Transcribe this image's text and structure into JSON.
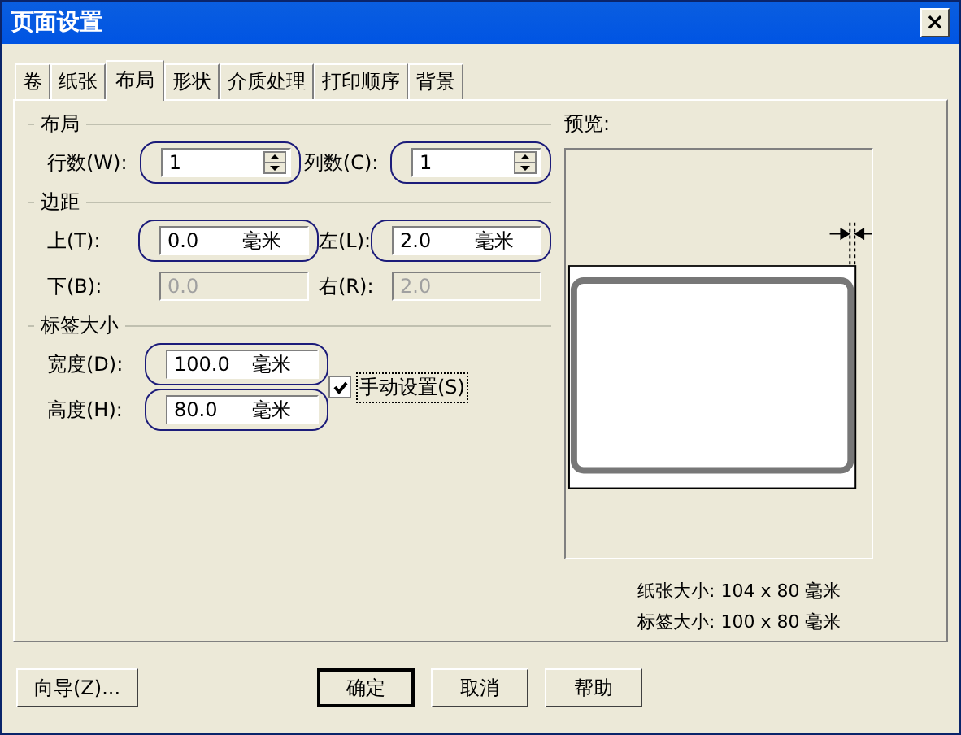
{
  "window": {
    "title": "页面设置",
    "close": "×"
  },
  "tabs": [
    {
      "label": "卷",
      "selected": false
    },
    {
      "label": "纸张",
      "selected": false
    },
    {
      "label": "布局",
      "selected": true
    },
    {
      "label": "形状",
      "selected": false
    },
    {
      "label": "介质处理",
      "selected": false
    },
    {
      "label": "打印顺序",
      "selected": false
    },
    {
      "label": "背景",
      "selected": false
    }
  ],
  "layout_group": {
    "title": "布局",
    "fields": [
      {
        "label": "行数(W):",
        "value": "1",
        "kind": "spinner",
        "highlighted": true,
        "disabled": false
      },
      {
        "label": "列数(C):",
        "value": "1",
        "kind": "spinner",
        "highlighted": true,
        "disabled": false
      }
    ]
  },
  "margins_group": {
    "title": "边距",
    "rows": [
      [
        {
          "label": "上(T):",
          "value": "0.0",
          "unit": "毫米",
          "kind": "unit",
          "highlighted": true,
          "disabled": false
        },
        {
          "label": "左(L):",
          "value": "2.0",
          "unit": "毫米",
          "kind": "unit",
          "highlighted": true,
          "disabled": false
        }
      ],
      [
        {
          "label": "下(B):",
          "value": "0.0",
          "kind": "plain",
          "disabled": true
        },
        {
          "label": "右(R):",
          "value": "2.0",
          "kind": "plain",
          "disabled": true
        }
      ]
    ]
  },
  "label_size_group": {
    "title": "标签大小",
    "fields": [
      {
        "label": "宽度(D):",
        "value": "100.0",
        "unit": "毫米",
        "kind": "unit",
        "highlighted": true,
        "disabled": false
      },
      {
        "label": "高度(H):",
        "value": "80.0",
        "unit": "毫米",
        "kind": "unit",
        "highlighted": true,
        "disabled": false
      }
    ],
    "manual": {
      "label": "手动设置(S)",
      "checked": true
    }
  },
  "preview": {
    "title": "预览:",
    "paper_size": "纸张大小: 104 x 80 毫米",
    "label_size": "标签大小: 100 x 80 毫米"
  },
  "buttons": [
    {
      "label": "向导(Z)...",
      "default": false
    },
    {
      "label": "确定",
      "default": true
    },
    {
      "label": "取消",
      "default": false
    },
    {
      "label": "帮助",
      "default": false
    }
  ]
}
